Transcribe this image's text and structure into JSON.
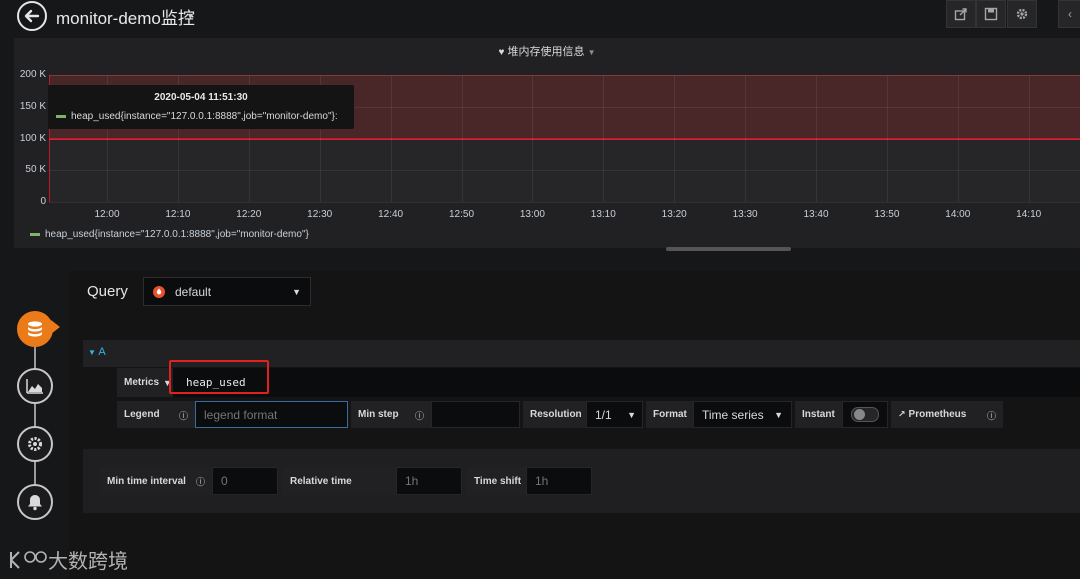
{
  "header": {
    "title": "monitor-demo监控",
    "toolbar": [
      "share-icon",
      "save-icon",
      "settings-icon",
      "chevron-left-icon"
    ]
  },
  "panel": {
    "title": "堆内存使用信息",
    "series_color": "#7eb26d",
    "threshold_color": "#c4162a",
    "tooltip": {
      "time": "2020-05-04 11:51:30",
      "series_label": "heap_used{instance=\"127.0.0.1:8888\",job=\"monitor-demo\"}:"
    },
    "legend": "heap_used{instance=\"127.0.0.1:8888\",job=\"monitor-demo\"}"
  },
  "chart_data": {
    "type": "line",
    "title": "堆内存使用信息",
    "y_ticks": [
      "0",
      "50 K",
      "100 K",
      "150 K",
      "200 K"
    ],
    "x_ticks": [
      "12:00",
      "12:10",
      "12:20",
      "12:30",
      "12:40",
      "12:50",
      "13:00",
      "13:10",
      "13:20",
      "13:30",
      "13:40",
      "13:50",
      "14:00",
      "14:10"
    ],
    "ylim": [
      0,
      200000
    ],
    "series": [
      {
        "name": "heap_used{instance=\"127.0.0.1:8888\",job=\"monitor-demo\"}",
        "values": [
          100000,
          100000,
          100000,
          100000,
          100000,
          100000,
          100000,
          100000,
          100000,
          100000,
          100000,
          100000,
          100000,
          100000
        ]
      }
    ],
    "legend_position": "bottom-left",
    "grid": true
  },
  "query": {
    "label": "Query",
    "datasource": "default",
    "row_name": "A",
    "metrics_label": "Metrics",
    "metrics_value": "heap_used",
    "legend_label": "Legend",
    "legend_placeholder": "legend format",
    "min_step_label": "Min step",
    "resolution_label": "Resolution",
    "resolution_value": "1/1",
    "format_label": "Format",
    "format_value": "Time series",
    "instant_label": "Instant",
    "prometheus_label": "Prometheus"
  },
  "options": {
    "min_interval_label": "Min time interval",
    "min_interval_placeholder": "0",
    "relative_time_label": "Relative time",
    "relative_time_placeholder": "1h",
    "time_shift_label": "Time shift",
    "time_shift_placeholder": "1h"
  },
  "rail": [
    "database-icon",
    "visualization-icon",
    "settings-gear-icon",
    "bell-icon"
  ],
  "accent_color": "#eb7b18",
  "watermark": "大数跨境"
}
